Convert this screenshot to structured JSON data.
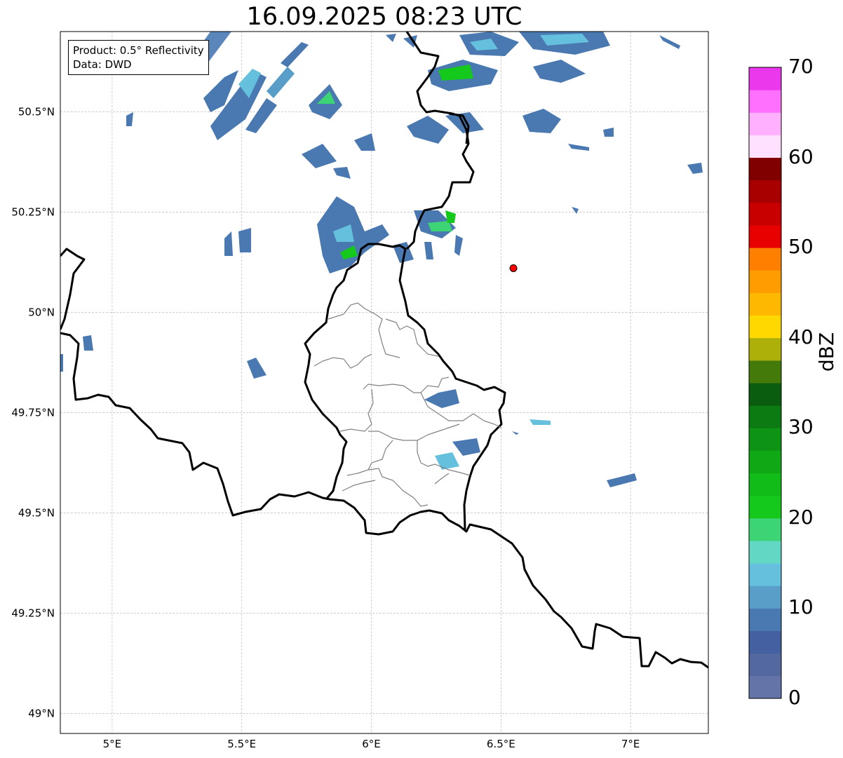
{
  "title": "16.09.2025 08:23 UTC",
  "info_box": {
    "product": "Product: 0.5° Reflectivity",
    "data": "Data: DWD"
  },
  "map": {
    "lon_range": [
      4.8,
      7.3
    ],
    "lat_range": [
      48.95,
      50.7
    ],
    "x_ticks": [
      {
        "v": 5.0,
        "label": "5°E"
      },
      {
        "v": 5.5,
        "label": "5.5°E"
      },
      {
        "v": 6.0,
        "label": "6°E"
      },
      {
        "v": 6.5,
        "label": "6.5°E"
      },
      {
        "v": 7.0,
        "label": "7°E"
      }
    ],
    "y_ticks": [
      {
        "v": 49.0,
        "label": "49°N"
      },
      {
        "v": 49.25,
        "label": "49.25°N"
      },
      {
        "v": 49.5,
        "label": "49.5°N"
      },
      {
        "v": 49.75,
        "label": "49.75°N"
      },
      {
        "v": 50.0,
        "label": "50°N"
      },
      {
        "v": 50.25,
        "label": "50.25°N"
      },
      {
        "v": 50.5,
        "label": "50.5°N"
      }
    ],
    "radar_site": {
      "lon": 6.548,
      "lat": 50.11,
      "color": "#ff0000"
    }
  },
  "colorbar": {
    "label": "dBZ",
    "min": 0,
    "max": 70,
    "ticks": [
      0,
      10,
      20,
      30,
      40,
      50,
      60,
      70
    ],
    "colors": [
      "#6474a8",
      "#5468a0",
      "#4460a0",
      "#4a78b0",
      "#589ec8",
      "#64c0dc",
      "#62d8c4",
      "#3cd474",
      "#14c81c",
      "#12bc18",
      "#10a814",
      "#0e9414",
      "#0c7c12",
      "#0a5c0e",
      "#447a0a",
      "#aeb00a",
      "#ffd800",
      "#ffb800",
      "#ff9c00",
      "#ff8000",
      "#e80000",
      "#c80000",
      "#a80000",
      "#800000",
      "#ffe0ff",
      "#ffb0ff",
      "#ff70ff",
      "#ec38ec"
    ]
  }
}
